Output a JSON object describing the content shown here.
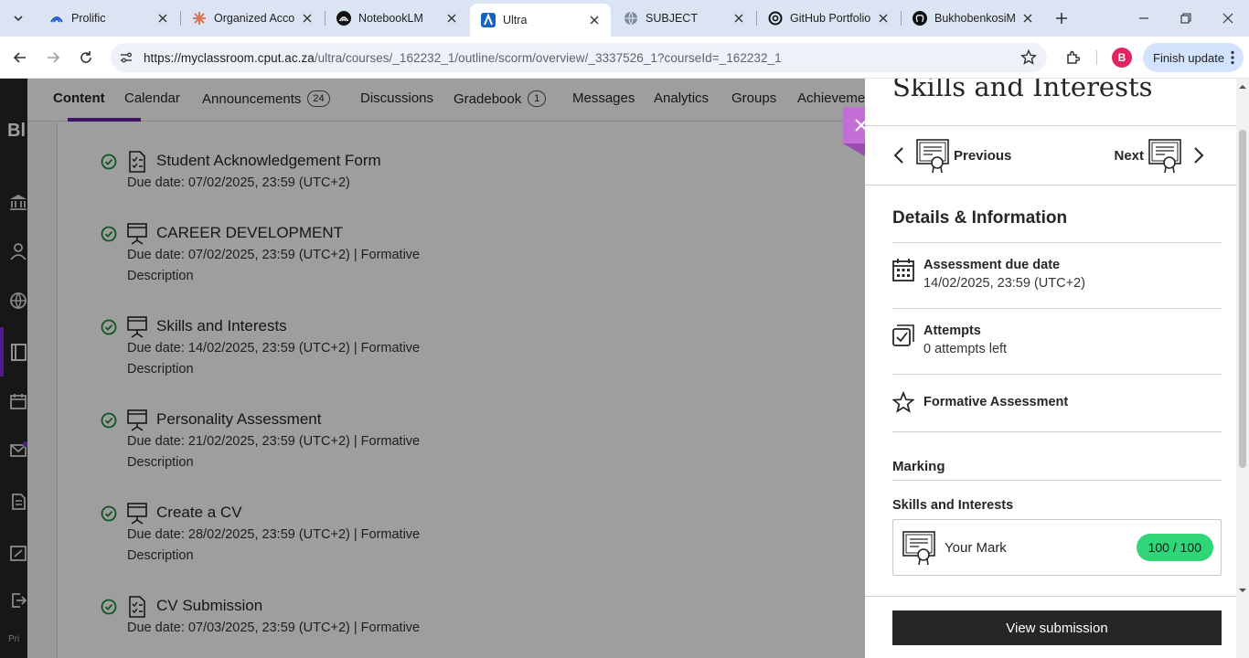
{
  "browser": {
    "tabs": [
      {
        "title": "Prolific",
        "icon": "prolific-icon",
        "active": false
      },
      {
        "title": "Organized Accou",
        "icon": "claude-icon",
        "active": false
      },
      {
        "title": "NotebookLM",
        "icon": "notebooklm-icon",
        "active": false
      },
      {
        "title": "Ultra",
        "icon": "blackboard-icon",
        "active": true
      },
      {
        "title": "SUBJECT",
        "icon": "globe-icon",
        "active": false
      },
      {
        "title": "GitHub Portfolio",
        "icon": "openai-icon",
        "active": false
      },
      {
        "title": "BukhobenkosiM",
        "icon": "github-icon",
        "active": false
      }
    ],
    "url_domain": "https://myclassroom.cput.ac.za",
    "url_path": "/ultra/courses/_162232_1/outline/scorm/overview/_3337526_1?courseId=_162232_1",
    "profile_initial": "B",
    "finish_update_label": "Finish update"
  },
  "course_nav": {
    "items": [
      {
        "label": "Content",
        "badge": ""
      },
      {
        "label": "Calendar",
        "badge": ""
      },
      {
        "label": "Announcements",
        "badge": "24"
      },
      {
        "label": "Discussions",
        "badge": ""
      },
      {
        "label": "Gradebook",
        "badge": "1"
      },
      {
        "label": "Messages",
        "badge": ""
      },
      {
        "label": "Analytics",
        "badge": ""
      },
      {
        "label": "Groups",
        "badge": ""
      },
      {
        "label": "Achieveme",
        "badge": ""
      }
    ]
  },
  "content_items": [
    {
      "title": "Student Acknowledgement Form",
      "meta": "Due date: 07/02/2025, 23:59 (UTC+2)",
      "description": ""
    },
    {
      "title": "CAREER DEVELOPMENT",
      "meta": "Due date: 07/02/2025, 23:59 (UTC+2)  |  Formative",
      "description": "Description"
    },
    {
      "title": "Skills and Interests",
      "meta": "Due date: 14/02/2025, 23:59 (UTC+2)  |  Formative",
      "description": "Description"
    },
    {
      "title": "Personality Assessment",
      "meta": "Due date: 21/02/2025, 23:59 (UTC+2)  |  Formative",
      "description": "Description"
    },
    {
      "title": "Create a CV",
      "meta": "Due date: 28/02/2025, 23:59 (UTC+2)  |  Formative",
      "description": "Description"
    },
    {
      "title": "CV Submission",
      "meta": "Due date: 07/03/2025, 23:59 (UTC+2)  |  Formative",
      "description": ""
    }
  ],
  "panel": {
    "title": "Skills and Interests",
    "previous_label": "Previous",
    "next_label": "Next",
    "details_heading": "Details & Information",
    "due_label": "Assessment due date",
    "due_value": "14/02/2025, 23:59 (UTC+2)",
    "attempts_label": "Attempts",
    "attempts_value": "0 attempts left",
    "formative_label": "Formative Assessment",
    "marking_heading": "Marking",
    "marking_item": "Skills and Interests",
    "your_mark_label": "Your Mark",
    "mark_value": "100 / 100",
    "view_submission_label": "View submission"
  },
  "colors": {
    "accent_purple": "#6b1fa6",
    "close_tab": "#c46fd6",
    "mark_green": "#2fd577",
    "check_green": "#1e8a3c"
  }
}
